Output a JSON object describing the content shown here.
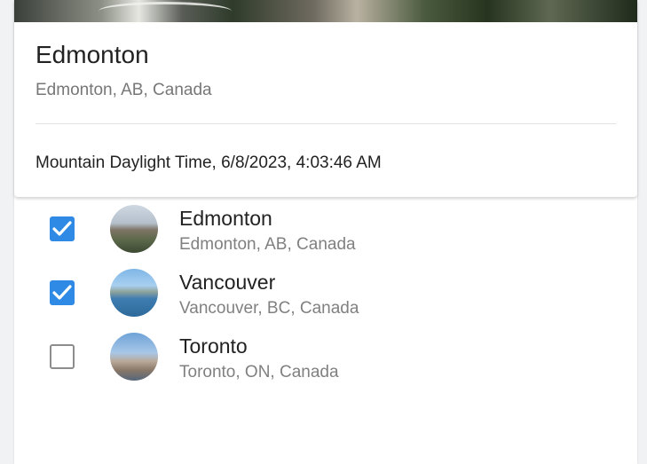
{
  "card": {
    "image_icon": "city-photo",
    "title": "Edmonton",
    "subtitle": "Edmonton, AB, Canada",
    "datetime": "Mountain Daylight Time, 6/8/2023, 4:03:46 AM"
  },
  "cities": [
    {
      "name": "Edmonton",
      "location": "Edmonton, AB, Canada",
      "checked": true,
      "avatar_icon": "edmonton-skyline-photo"
    },
    {
      "name": "Vancouver",
      "location": "Vancouver, BC, Canada",
      "checked": true,
      "avatar_icon": "vancouver-skyline-photo"
    },
    {
      "name": "Toronto",
      "location": "Toronto, ON, Canada",
      "checked": false,
      "avatar_icon": "toronto-skyline-photo"
    }
  ],
  "colors": {
    "accent": "#2f8ae5",
    "text_primary": "#222222",
    "text_secondary": "#808080"
  }
}
